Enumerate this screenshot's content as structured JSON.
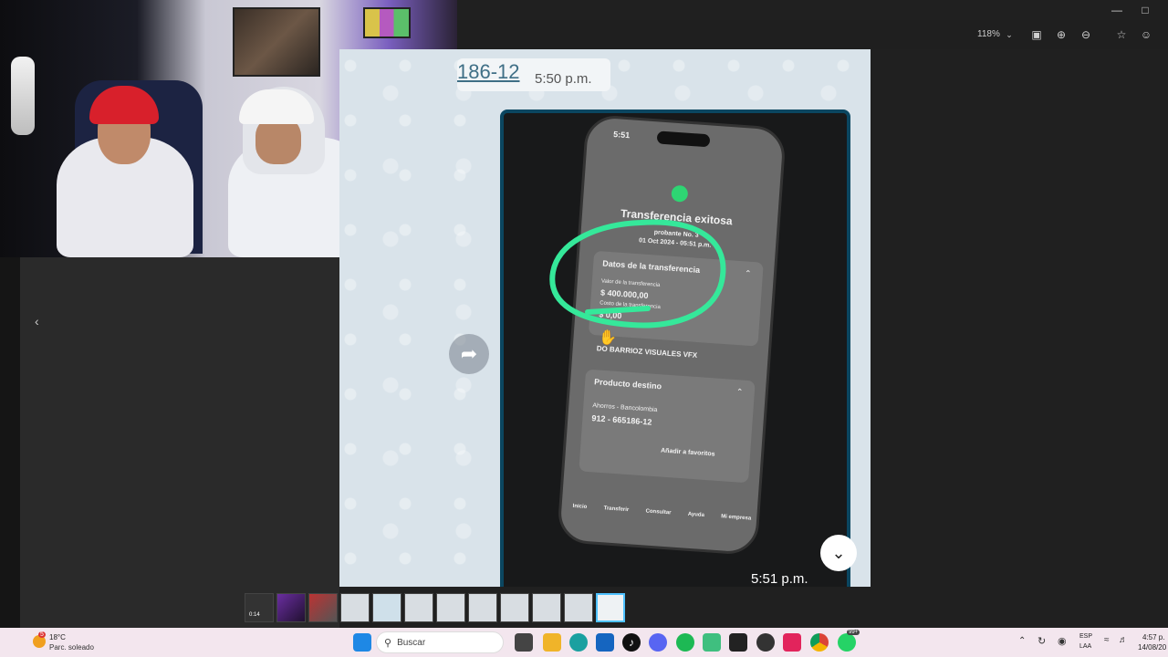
{
  "toolbar": {
    "zoom": "118%"
  },
  "chat": {
    "header_number": "186-12",
    "header_time": "5:50 p.m.",
    "video_time": "5:51 p.m."
  },
  "phone": {
    "status_time": "5:51",
    "title": "Transferencia exitosa",
    "receipt": "01 Oct 2024 - 05:51 p.m.",
    "receipt_label": "probante No. 3",
    "transfer_section": "Datos de la transferencia",
    "transfer_value_label": "Valor de la transferencia",
    "transfer_value": "$ 400.000,00",
    "cost_label": "Costo de la transferencia",
    "cost_value": "$ 0,00",
    "recipient": "DO BARRIOZ VISUALES VFX",
    "destination_section": "Producto destino",
    "account_type": "Ahorros - Bancolombia",
    "account_number": "912 - 665186-12",
    "add_favorites": "Añadir a favoritos",
    "nav": [
      "Inicio",
      "Transferir",
      "Consultar",
      "Ayuda",
      "Mi empresa"
    ]
  },
  "taskbar": {
    "weather_temp": "18°C",
    "weather_desc": "Parc. soleado",
    "weather_badge": "5",
    "search_placeholder": "Buscar",
    "lang_top": "ESP",
    "lang_bottom": "LAA",
    "clock_time": "4:57 p.",
    "clock_date": "14/08/20",
    "notif_badge": "99+"
  },
  "thumbnail": {
    "video_duration": "0:14"
  },
  "colors": {
    "highlight": "#35e89a",
    "chat_bg": "#d9e3ea",
    "frame_border": "#0b4660"
  }
}
